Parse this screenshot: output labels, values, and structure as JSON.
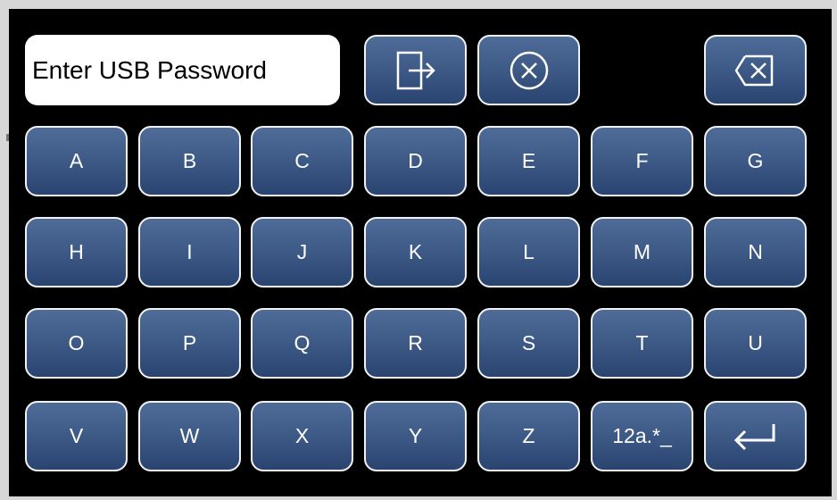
{
  "password_input": {
    "placeholder": "Enter USB Password"
  },
  "toolbar": {
    "login_icon": "login-arrow-icon",
    "cancel_icon": "circle-x-icon",
    "backspace_icon": "backspace-icon"
  },
  "keyboard": {
    "rows": [
      [
        "A",
        "B",
        "C",
        "D",
        "E",
        "F",
        "G"
      ],
      [
        "H",
        "I",
        "J",
        "K",
        "L",
        "M",
        "N"
      ],
      [
        "O",
        "P",
        "Q",
        "R",
        "S",
        "T",
        "U"
      ],
      [
        "V",
        "W",
        "X",
        "Y",
        "Z"
      ]
    ],
    "mode_key_label": "12a.*_",
    "enter_icon": "enter-arrow-icon"
  },
  "colors": {
    "key_top": "#4f6b97",
    "key_bottom": "#2a4470",
    "key_border": "#f2f2f2",
    "background": "#000000"
  }
}
